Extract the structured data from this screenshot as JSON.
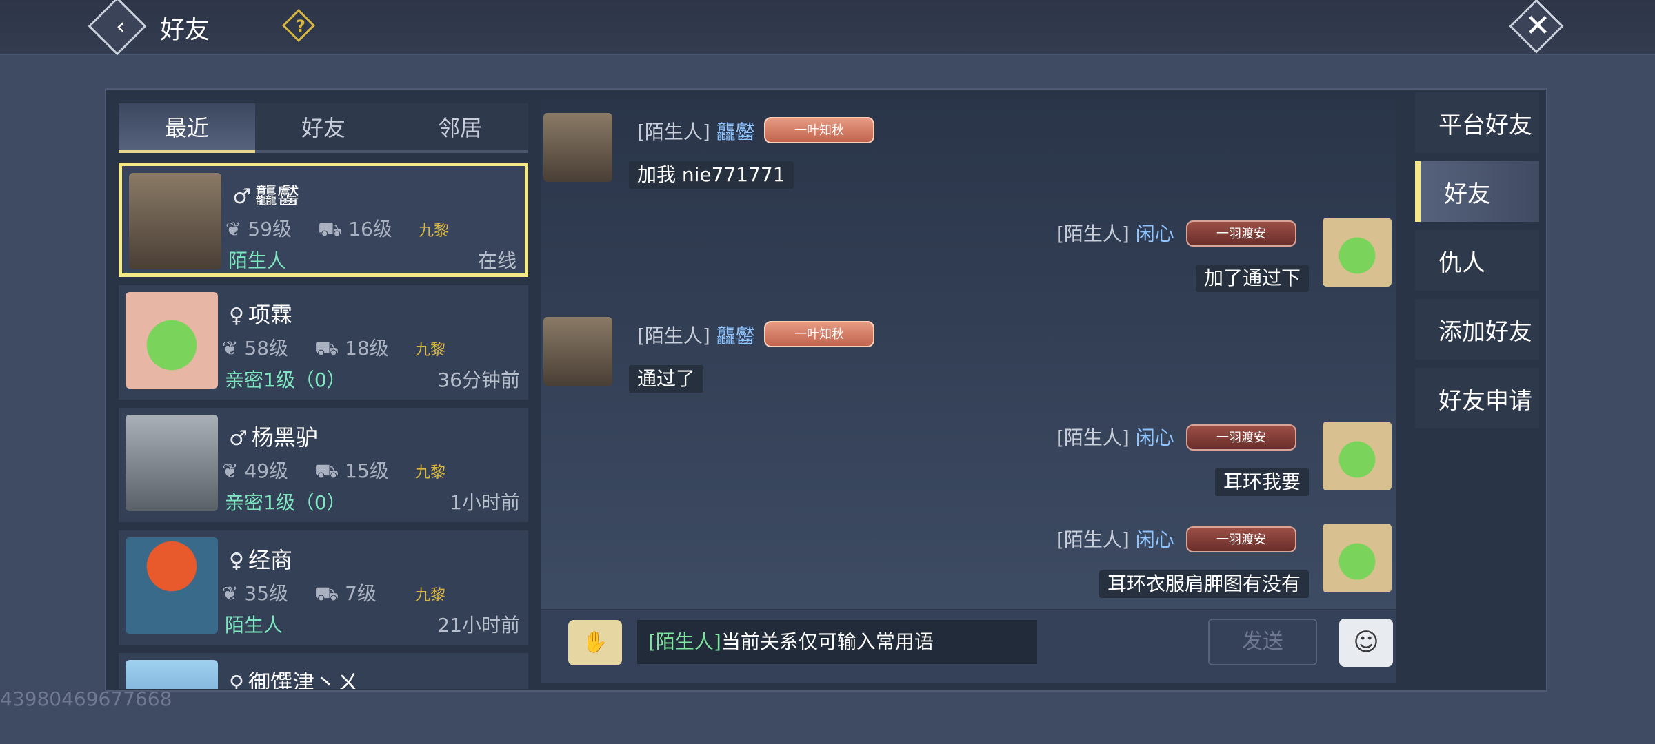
{
  "header": {
    "title": "好友",
    "help_icon": "?",
    "back_icon": "‹",
    "close_icon": "✕"
  },
  "tabs": [
    {
      "label": "最近",
      "active": true
    },
    {
      "label": "好友",
      "active": false
    },
    {
      "label": "邻居",
      "active": false
    }
  ],
  "friends": [
    {
      "gender": "♂",
      "name": "龘齾",
      "level": "59级",
      "mount_level": "16级",
      "rank": "九黎",
      "relation": "陌生人",
      "time": "在线"
    },
    {
      "gender": "♀",
      "name": "项霖",
      "level": "58级",
      "mount_level": "18级",
      "rank": "九黎",
      "relation": "亲密1级（0）",
      "time": "36分钟前"
    },
    {
      "gender": "♂",
      "name": "杨黑驴",
      "level": "49级",
      "mount_level": "15级",
      "rank": "九黎",
      "relation": "亲密1级（0）",
      "time": "1小时前"
    },
    {
      "gender": "♀",
      "name": "经商",
      "level": "35级",
      "mount_level": "7级",
      "rank": "九黎",
      "relation": "陌生人",
      "time": "21小时前"
    },
    {
      "gender": "♀",
      "name": "御馔津丶ㄨ",
      "level": "",
      "mount_level": "",
      "rank": "",
      "relation": "",
      "time": ""
    }
  ],
  "messages": [
    {
      "side": "left",
      "prefix": "[陌生人]",
      "name": "龘齾",
      "badge": "一叶知秋",
      "text": "加我 nie771771"
    },
    {
      "side": "right",
      "prefix": "[陌生人]",
      "name": "闲心",
      "badge": "一羽渡安",
      "text": "加了通过下"
    },
    {
      "side": "left",
      "prefix": "[陌生人]",
      "name": "龘齾",
      "badge": "一叶知秋",
      "text": "通过了"
    },
    {
      "side": "right",
      "prefix": "[陌生人]",
      "name": "闲心",
      "badge": "一羽渡安",
      "text": "耳环我要"
    },
    {
      "side": "right",
      "prefix": "[陌生人]",
      "name": "闲心",
      "badge": "一羽渡安",
      "text": "耳环衣服肩胛图有没有"
    }
  ],
  "input": {
    "tag": "[陌生人]",
    "placeholder": "当前关系仅可输入常用语"
  },
  "send_label": "发送",
  "side_menu": [
    {
      "label": "平台好友",
      "active": false
    },
    {
      "label": "好友",
      "active": true
    },
    {
      "label": "仇人",
      "active": false
    },
    {
      "label": "添加好友",
      "active": false
    },
    {
      "label": "好友申请",
      "active": false
    }
  ],
  "uid": "43980469677668",
  "colors": {
    "accent": "#f4e889",
    "relation_green": "#7ee6c0",
    "name_blue": "#8fc4ff",
    "rank_gold": "#d8b740"
  }
}
